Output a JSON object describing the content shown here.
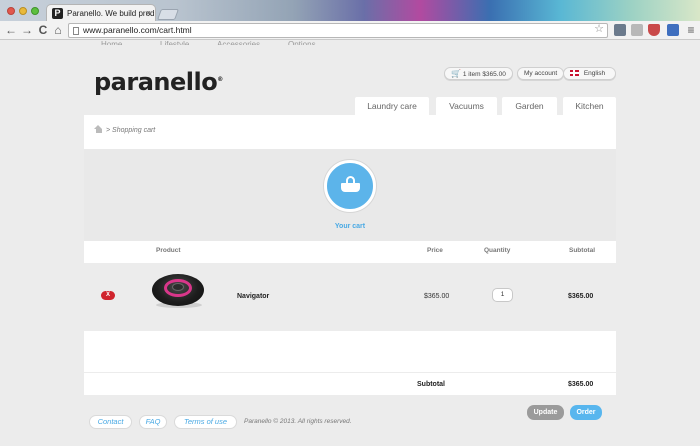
{
  "browser": {
    "tab_title": "Paranello. We build produ",
    "tab_favicon_letter": "P",
    "tab_close": "×",
    "url": "www.paranello.com/cart.html",
    "back": "←",
    "forward": "→",
    "reload": "C",
    "home": "⌂",
    "star": "☆",
    "menu": "≡"
  },
  "site": {
    "logo": "paranello",
    "logo_mark": "®",
    "cut_nav": [
      "Home",
      "Lifestyle",
      "Accessories",
      "Options"
    ],
    "header": {
      "cart_summary": "1 item $365.00",
      "my_account": "My account",
      "language": "English"
    },
    "categories": [
      "Laundry care",
      "Vacuums",
      "Garden",
      "Kitchen"
    ],
    "breadcrumb": {
      "separator": ">",
      "current": "Shopping cart"
    },
    "hero_label": "Your cart",
    "table": {
      "headers": {
        "product": "Product",
        "price": "Price",
        "quantity": "Quantity",
        "subtotal": "Subtotal"
      },
      "items": [
        {
          "remove_label": "X",
          "name": "Navigator",
          "price": "$365.00",
          "quantity": "1",
          "subtotal": "$365.00"
        }
      ],
      "summary_label": "Subtotal",
      "summary_value": "$365.00"
    },
    "buttons": {
      "update": "Update",
      "order": "Order"
    },
    "footer": {
      "links": [
        "Contact",
        "FAQ",
        "Terms of use"
      ],
      "copyright": "Paranello © 2013. All rights reserved."
    }
  },
  "colors": {
    "accent": "#58b6ee",
    "remove": "#d0242d",
    "product_ring": "#d9368a"
  }
}
